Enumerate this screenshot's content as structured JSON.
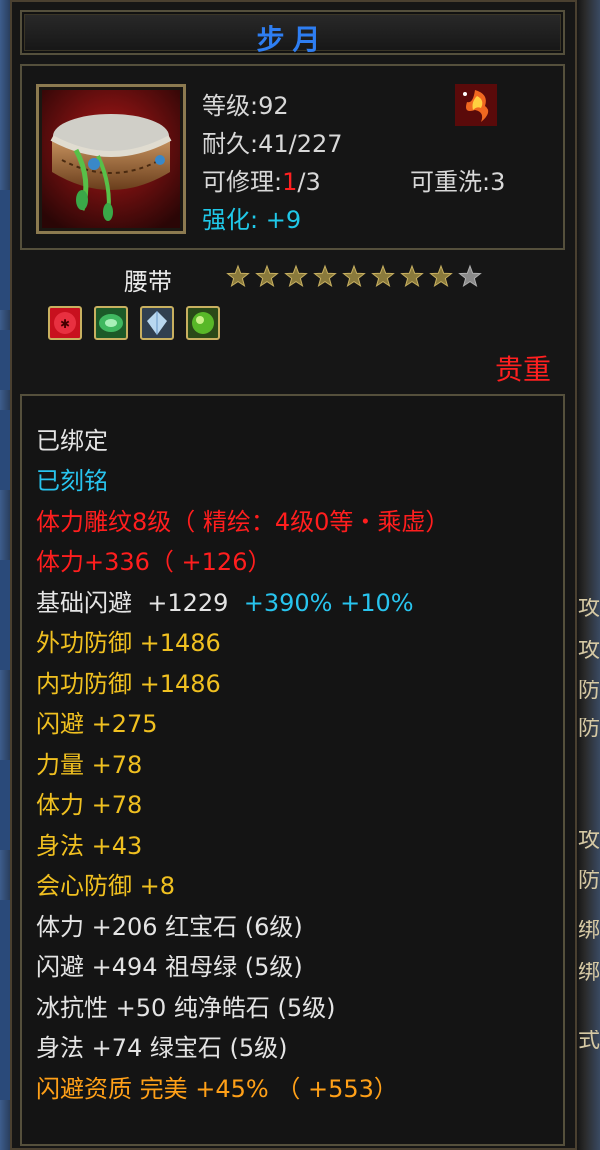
{
  "item": {
    "name": "步月",
    "level_label": "等级:",
    "level": "92",
    "durability_label": "耐久:",
    "durability": "41/227",
    "repair_label": "可修理:",
    "repair_used": "1",
    "repair_total": "/3",
    "rewash_label": "可重洗:",
    "rewash": "3",
    "enhance_label": "强化:",
    "enhance": "+9",
    "type": "腰带",
    "stars_filled": 8,
    "stars_total": 9,
    "rarity": "贵重"
  },
  "gems": [
    {
      "name": "red-gem-icon",
      "color": "#c8101e"
    },
    {
      "name": "green-gem-icon",
      "color": "#28a040"
    },
    {
      "name": "ice-gem-icon",
      "color": "#a8c8d8"
    },
    {
      "name": "emerald-gem-icon",
      "color": "#50b020"
    }
  ],
  "attributes": {
    "bound": "已绑定",
    "engraved": "已刻铭",
    "carving": "体力雕纹8级（ 精绘：4级0等・乘虚）",
    "stamina_main": "体力+336（ +126）",
    "base_dodge_label": "基础闪避",
    "base_dodge_value": "+1229",
    "base_dodge_pct1": "+390%",
    "base_dodge_pct2": "+10%",
    "outer_def": "外功防御  +1486",
    "inner_def": "内功防御  +1486",
    "dodge": "闪避  +275",
    "strength": "力量  +78",
    "stamina": "体力  +78",
    "agility": "身法  +43",
    "crit_def": "会心防御  +8",
    "gem1": "体力  +206  红宝石 (6级)",
    "gem2": "闪避  +494  祖母绿 (5级)",
    "gem3": "冰抗性  +50  纯净皓石 (5级)",
    "gem4": "身法  +74  绿宝石 (5级)",
    "aptitude": "闪避资质    完美  +45% （ +553）"
  },
  "right_panel": [
    "攻",
    "攻",
    "防",
    "防",
    "攻",
    "防",
    "绑",
    "绑",
    "式"
  ],
  "colors": {
    "title": "#2e7ef2",
    "cyan": "#28c4ee",
    "red": "#ff1e1e",
    "gold": "#f0c020",
    "orange": "#ffa018",
    "border": "#55503c"
  }
}
